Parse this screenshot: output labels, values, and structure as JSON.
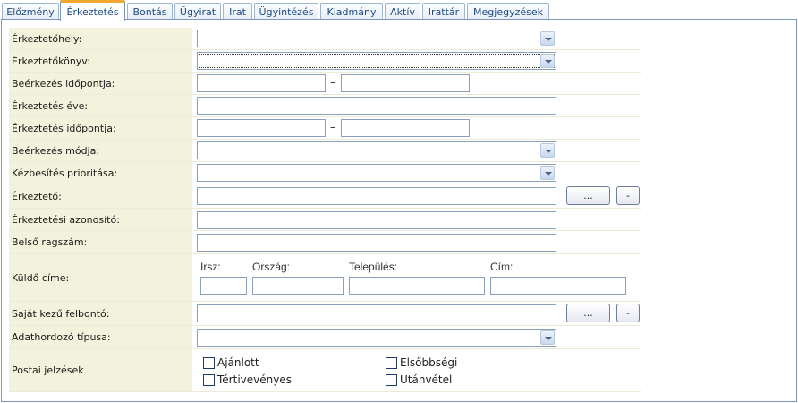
{
  "tabs": [
    {
      "label": "Előzmény",
      "active": false
    },
    {
      "label": "Érkeztetés",
      "active": true
    },
    {
      "label": "Bontás",
      "active": false
    },
    {
      "label": "Ügyirat",
      "active": false
    },
    {
      "label": "Irat",
      "active": false
    },
    {
      "label": "Ügyintézés",
      "active": false
    },
    {
      "label": "Kiadmány",
      "active": false
    },
    {
      "label": "Aktív",
      "active": false
    },
    {
      "label": "Irattár",
      "active": false
    },
    {
      "label": "Megjegyzések",
      "active": false
    }
  ],
  "form": {
    "erkeztetohely": {
      "label": "Érkeztetőhely:",
      "value": ""
    },
    "erkeztetokonyv": {
      "label": "Érkeztetőkönyv:",
      "value": ""
    },
    "beerkezes_idopontja": {
      "label": "Beérkezés időpontja:",
      "from": "",
      "to": "",
      "separator": "–"
    },
    "erkeztetes_eve": {
      "label": "Érkeztetés éve:",
      "value": ""
    },
    "erkeztetes_idopontja": {
      "label": "Érkeztetés időpontja:",
      "from": "",
      "to": "",
      "separator": "–"
    },
    "beerkezes_modja": {
      "label": "Beérkezés módja:",
      "value": ""
    },
    "kezbesites_prioritasa": {
      "label": "Kézbesítés prioritása:",
      "value": ""
    },
    "erkezteto": {
      "label": "Érkeztető:",
      "value": "",
      "browse_label": "...",
      "clear_label": "-"
    },
    "erkeztetesi_azonosito": {
      "label": "Érkeztetési azonosító:",
      "value": ""
    },
    "belso_ragszam": {
      "label": "Belső ragszám:",
      "value": ""
    },
    "kuldo_cime": {
      "label": "Küldő címe:",
      "irsz_label": "Irsz:",
      "irsz": "",
      "orszag_label": "Ország:",
      "orszag": "",
      "telepules_label": "Település:",
      "telepules": "",
      "cim_label": "Cím:",
      "cim": ""
    },
    "sajat_kezu_felbonto": {
      "label": "Saját kezű felbontó:",
      "value": "",
      "browse_label": "...",
      "clear_label": "-"
    },
    "adathordozo_tipusa": {
      "label": "Adathordozó típusa:",
      "value": ""
    },
    "postai_jelzesek": {
      "label": "Postai jelzések",
      "options": [
        {
          "label": "Ajánlott",
          "checked": false
        },
        {
          "label": "Elsőbbségi",
          "checked": false
        },
        {
          "label": "Tértivevényes",
          "checked": false
        },
        {
          "label": "Utánvétel",
          "checked": false
        }
      ]
    }
  }
}
